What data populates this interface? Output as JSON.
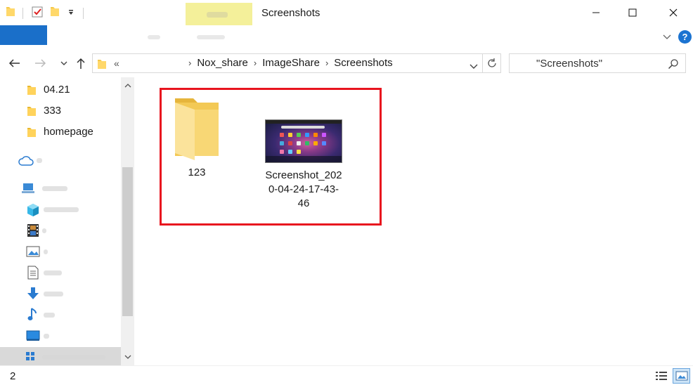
{
  "window": {
    "title": "Screenshots"
  },
  "quick_access": {
    "icons": [
      "folder-icon",
      "properties-check-icon",
      "new-folder-icon",
      "customize-dropdown-icon"
    ]
  },
  "address_bar": {
    "overflow": "«",
    "crumbs": [
      "Nox_share",
      "ImageShare",
      "Screenshots"
    ]
  },
  "search": {
    "placeholder": "\"Screenshots\""
  },
  "sidebar": {
    "items": [
      {
        "label": "04.21",
        "icon": "folder-icon"
      },
      {
        "label": "333",
        "icon": "folder-icon"
      },
      {
        "label": "homepage",
        "icon": "folder-icon"
      },
      {
        "label": "",
        "icon": "cloud-icon"
      },
      {
        "label": "",
        "icon": "this-pc-icon"
      },
      {
        "label": "",
        "icon": "3d-objects-icon"
      },
      {
        "label": "",
        "icon": "videos-icon"
      },
      {
        "label": "",
        "icon": "pictures-icon"
      },
      {
        "label": "",
        "icon": "documents-icon"
      },
      {
        "label": "",
        "icon": "downloads-icon"
      },
      {
        "label": "",
        "icon": "music-icon"
      },
      {
        "label": "",
        "icon": "desktop-icon"
      },
      {
        "label": "",
        "icon": "windows-drive-icon"
      }
    ]
  },
  "files": [
    {
      "name": "123",
      "type": "folder",
      "icon": "folder-icon"
    },
    {
      "name": "Screenshot_2020-04-24-17-43-46",
      "name_lines": [
        "Screenshot_202",
        "0-04-24-17-43-",
        "46"
      ],
      "type": "image",
      "icon": "image-thumbnail"
    }
  ],
  "status": {
    "item_count": "2"
  },
  "colors": {
    "accent": "#1a6fc9",
    "highlight_border": "#e8141e",
    "context_tab": "#f4f09a",
    "folder_yellow": "#f8d775"
  }
}
